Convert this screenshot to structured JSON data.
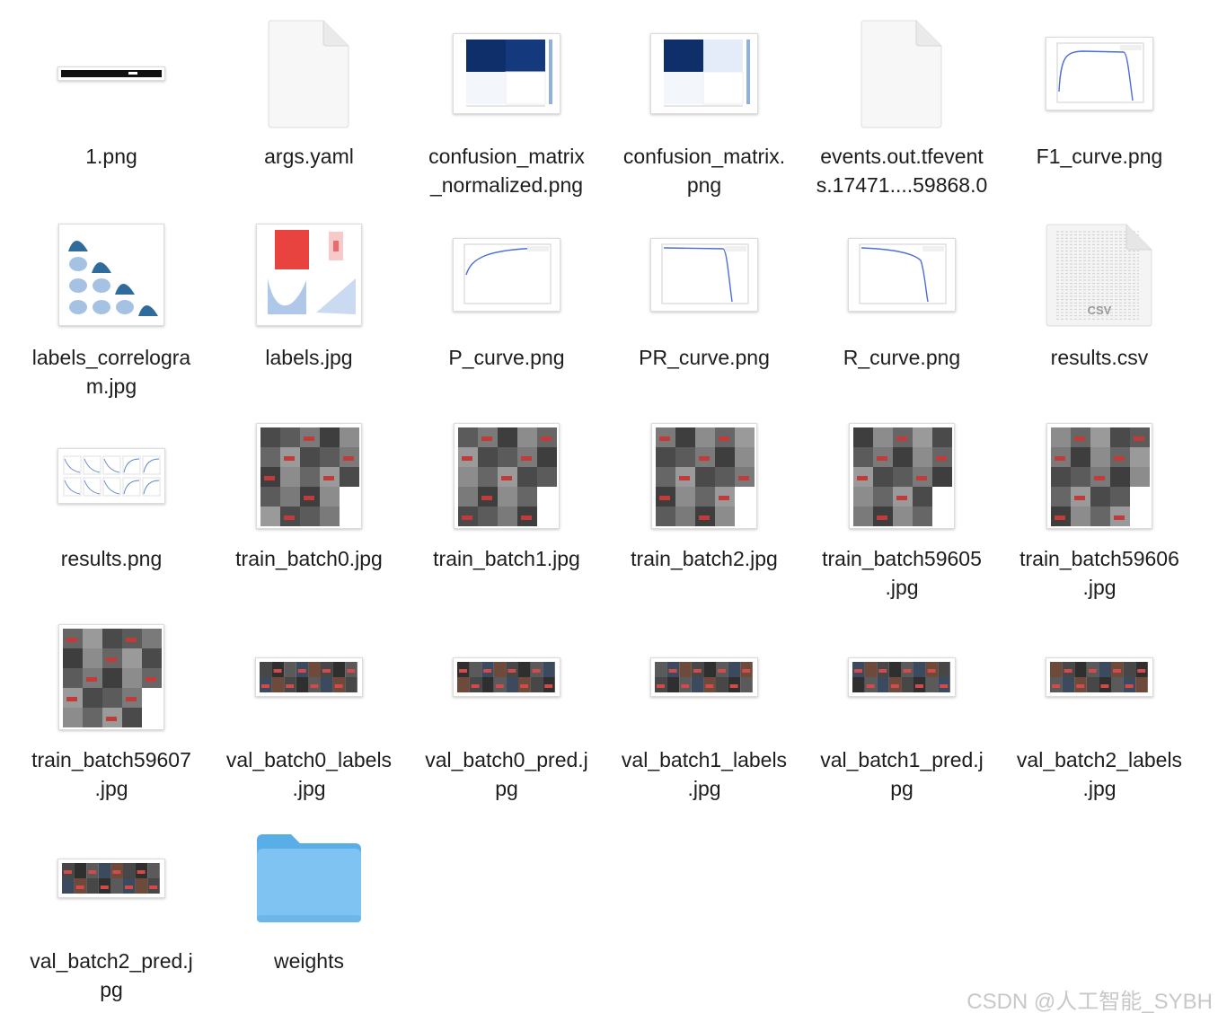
{
  "files": [
    {
      "label": "1.png",
      "kind": "strip"
    },
    {
      "label": "args.yaml",
      "kind": "doc"
    },
    {
      "label": "confusion_matrix\n_normalized.png",
      "kind": "cm_norm"
    },
    {
      "label": "confusion_matrix.\npng",
      "kind": "cm"
    },
    {
      "label": "events.out.tfevent\ns.17471....59868.0",
      "kind": "doc"
    },
    {
      "label": "F1_curve.png",
      "kind": "curve_f1"
    },
    {
      "label": "labels_correlogra\nm.jpg",
      "kind": "correlogram"
    },
    {
      "label": "labels.jpg",
      "kind": "labels"
    },
    {
      "label": "P_curve.png",
      "kind": "curve_p"
    },
    {
      "label": "PR_curve.png",
      "kind": "curve_pr"
    },
    {
      "label": "R_curve.png",
      "kind": "curve_r"
    },
    {
      "label": "results.csv",
      "kind": "csv",
      "badge": "CSV"
    },
    {
      "label": "results.png",
      "kind": "results"
    },
    {
      "label": "train_batch0.jpg",
      "kind": "batch"
    },
    {
      "label": "train_batch1.jpg",
      "kind": "batch"
    },
    {
      "label": "train_batch2.jpg",
      "kind": "batch"
    },
    {
      "label": "train_batch59605\n.jpg",
      "kind": "batch"
    },
    {
      "label": "train_batch59606\n.jpg",
      "kind": "batch"
    },
    {
      "label": "train_batch59607\n.jpg",
      "kind": "batch"
    },
    {
      "label": "val_batch0_labels\n.jpg",
      "kind": "val"
    },
    {
      "label": "val_batch0_pred.j\npg",
      "kind": "val"
    },
    {
      "label": "val_batch1_labels\n.jpg",
      "kind": "val"
    },
    {
      "label": "val_batch1_pred.j\npg",
      "kind": "val"
    },
    {
      "label": "val_batch2_labels\n.jpg",
      "kind": "val"
    },
    {
      "label": "val_batch2_pred.j\npg",
      "kind": "val"
    },
    {
      "label": "weights",
      "kind": "folder"
    }
  ],
  "watermark": "CSDN @人工智能_SYBH",
  "colors": {
    "folder": "#7ec3f2",
    "folder_dark": "#5aaee8",
    "cm_dark": "#0f2f6b",
    "curve": "#4a6fd6",
    "heat_red": "#e8433f"
  }
}
